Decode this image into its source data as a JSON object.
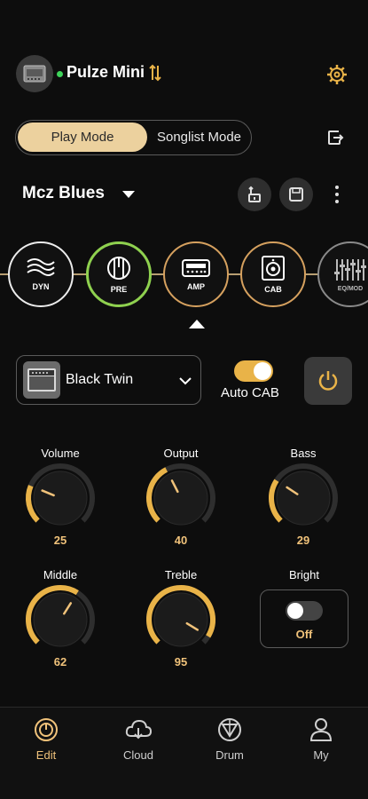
{
  "header": {
    "device_name": "Pulze Mini",
    "connected_color": "#3ed35a",
    "device_icon": "amp-head-icon",
    "swap_icon": "swap-icon",
    "settings_icon": "gear-settings-icon"
  },
  "mode": {
    "play_label": "Play Mode",
    "songlist_label": "Songlist Mode",
    "active": "Play Mode",
    "export_icon": "export-icon"
  },
  "preset": {
    "name": "Mcz Blues",
    "tuner_icon": "tuner-icon",
    "save_icon": "save-icon",
    "more_icon": "more-vertical-icon"
  },
  "chain": [
    {
      "id": "dyn",
      "label": "DYN",
      "icon": "waves-icon",
      "color": "#ececec"
    },
    {
      "id": "pre",
      "label": "PRE",
      "icon": "preamp-icon",
      "color": "#8fd14f"
    },
    {
      "id": "amp",
      "label": "AMP",
      "icon": "amp-icon",
      "color": "#d6a15f"
    },
    {
      "id": "cab",
      "label": "CAB",
      "icon": "speaker-icon",
      "color": "#d6a15f"
    },
    {
      "id": "eq",
      "label": "EQ/MOD",
      "icon": "eq-sliders-icon",
      "color": "#8a8a8a"
    }
  ],
  "model": {
    "name": "Black Twin",
    "auto_cab_label": "Auto CAB",
    "auto_cab_on": true,
    "power_icon": "power-icon"
  },
  "knobs": [
    {
      "label": "Volume",
      "value": "25"
    },
    {
      "label": "Output",
      "value": "40"
    },
    {
      "label": "Bass",
      "value": "29"
    },
    {
      "label": "Middle",
      "value": "62"
    },
    {
      "label": "Treble",
      "value": "95"
    }
  ],
  "bright": {
    "label": "Bright",
    "state": "Off"
  },
  "nav": [
    {
      "label": "Edit",
      "icon": "edit-knob-icon",
      "active": true
    },
    {
      "label": "Cloud",
      "icon": "cloud-icon",
      "active": false
    },
    {
      "label": "Drum",
      "icon": "drum-icon",
      "active": false
    },
    {
      "label": "My",
      "icon": "user-icon",
      "active": false
    }
  ],
  "colors": {
    "accent": "#f0c27a",
    "accent_bg": "#ecd19e",
    "switch_on": "#e9b348"
  }
}
